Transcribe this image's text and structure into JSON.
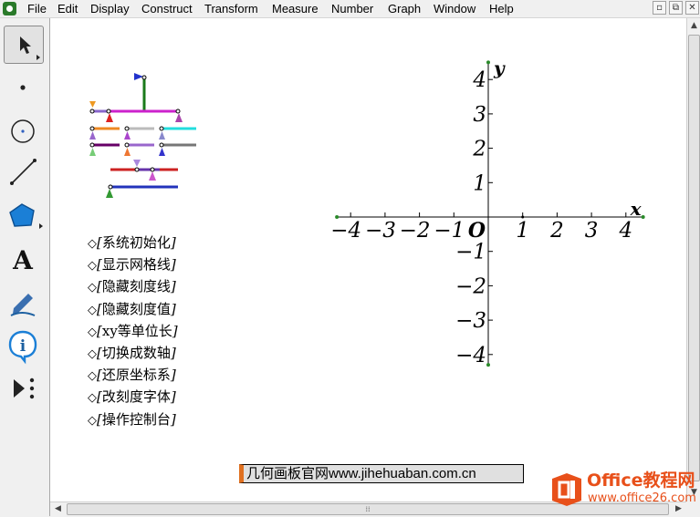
{
  "menu": [
    "File",
    "Edit",
    "Display",
    "Construct",
    "Transform",
    "Measure",
    "Number",
    "Graph",
    "Window",
    "Help"
  ],
  "window_controls": {
    "minimize": "▫",
    "restore": "⧉",
    "close": "✕"
  },
  "tools": [
    {
      "name": "arrow-select-tool",
      "icon": "arrow-icon",
      "selected": true
    },
    {
      "name": "point-tool",
      "icon": "point-icon"
    },
    {
      "name": "compass-tool",
      "icon": "compass-icon"
    },
    {
      "name": "straightedge-tool",
      "icon": "segment-icon"
    },
    {
      "name": "polygon-tool",
      "icon": "polygon-icon"
    },
    {
      "name": "text-tool",
      "icon": "text-icon"
    },
    {
      "name": "marker-tool",
      "icon": "marker-icon"
    },
    {
      "name": "information-tool",
      "icon": "info-icon"
    },
    {
      "name": "custom-tool",
      "icon": "custom-tools-icon"
    }
  ],
  "tool_glyphs": {
    "text": "A",
    "info": "i"
  },
  "action_buttons": [
    {
      "marker": "◇",
      "label": "系统初始化"
    },
    {
      "marker": "◇",
      "label": "显示网格线"
    },
    {
      "marker": "◇",
      "label": "隐藏刻度线"
    },
    {
      "marker": "◇",
      "label": "隐藏刻度值"
    },
    {
      "marker": "◇",
      "label": "xy等单位长"
    },
    {
      "marker": "◇",
      "label": "切换成数轴"
    },
    {
      "marker": "◇",
      "label": "还原坐标系"
    },
    {
      "marker": "◇",
      "label": "改刻度字体"
    },
    {
      "marker": "◇",
      "label": "操作控制台"
    }
  ],
  "button_brackets": {
    "open": "[",
    "close": "]"
  },
  "axes": {
    "x_label": "x",
    "y_label": "y",
    "origin_label": "O",
    "x_ticks": [
      -4,
      -3,
      -2,
      -1,
      1,
      2,
      3,
      4
    ],
    "y_ticks": [
      4,
      3,
      2,
      1,
      -1,
      -2,
      -3,
      -4
    ],
    "x_range": [
      -4.4,
      4.5
    ],
    "y_range": [
      -4.3,
      4.5
    ],
    "unit": "1"
  },
  "banner": {
    "text": "几何画板官网www.jihehuaban.com.cn"
  },
  "watermark": {
    "line1": "Office教程网",
    "line2": "www.office26.com"
  },
  "colors": {
    "accent": "#e07020",
    "watermark": "#e8501a"
  },
  "hscroll_grip": "⁞⁞"
}
